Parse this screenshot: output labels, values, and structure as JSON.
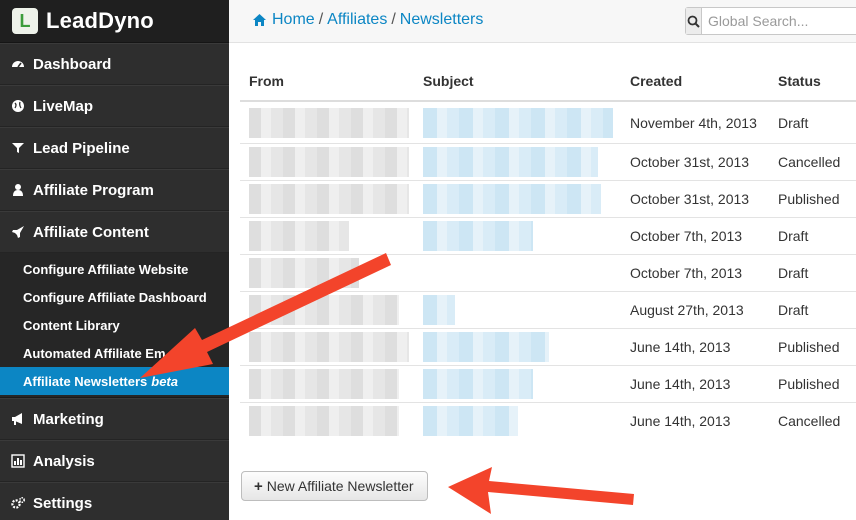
{
  "brand": {
    "logo_letter": "L",
    "name": "LeadDyno"
  },
  "nav": [
    {
      "key": "dashboard",
      "label": "Dashboard",
      "icon": "dashboard-icon"
    },
    {
      "key": "livemap",
      "label": "LiveMap",
      "icon": "globe-icon"
    },
    {
      "key": "lead-pipeline",
      "label": "Lead Pipeline",
      "icon": "filter-icon"
    },
    {
      "key": "affiliate-program",
      "label": "Affiliate Program",
      "icon": "user-icon"
    },
    {
      "key": "affiliate-content",
      "label": "Affiliate Content",
      "icon": "rocket-icon"
    }
  ],
  "subnav": [
    {
      "label": "Configure Affiliate Website"
    },
    {
      "label": "Configure Affiliate Dashboard"
    },
    {
      "label": "Content Library"
    },
    {
      "label": "Automated Affiliate Em"
    },
    {
      "label": "Affiliate Newsletters",
      "badge": "beta",
      "active": true
    }
  ],
  "nav_bottom": [
    {
      "key": "marketing",
      "label": "Marketing",
      "icon": "bullhorn-icon"
    },
    {
      "key": "analysis",
      "label": "Analysis",
      "icon": "bar-chart-icon"
    },
    {
      "key": "settings",
      "label": "Settings",
      "icon": "gears-icon"
    }
  ],
  "breadcrumb": {
    "home": "Home",
    "sep": "/",
    "affiliates": "Affiliates",
    "current": "Newsletters"
  },
  "search": {
    "placeholder": "Global Search..."
  },
  "table": {
    "headers": {
      "from": "From",
      "subject": "Subject",
      "created": "Created",
      "status": "Status"
    },
    "rows": [
      {
        "created": "November 4th, 2013",
        "status": "Draft"
      },
      {
        "created": "October 31st, 2013",
        "status": "Cancelled"
      },
      {
        "created": "October 31st, 2013",
        "status": "Published"
      },
      {
        "created": "October 7th, 2013",
        "status": "Draft"
      },
      {
        "created": "October 7th, 2013",
        "status": "Draft"
      },
      {
        "created": "August 27th, 2013",
        "status": "Draft"
      },
      {
        "created": "June 14th, 2013",
        "status": "Published"
      },
      {
        "created": "June 14th, 2013",
        "status": "Published"
      },
      {
        "created": "June 14th, 2013",
        "status": "Cancelled"
      }
    ]
  },
  "new_button": {
    "label": "New Affiliate Newsletter"
  },
  "colors": {
    "accent": "#0c86c4",
    "sidebar": "#2e2e2e",
    "annotation": "#f3442b"
  }
}
